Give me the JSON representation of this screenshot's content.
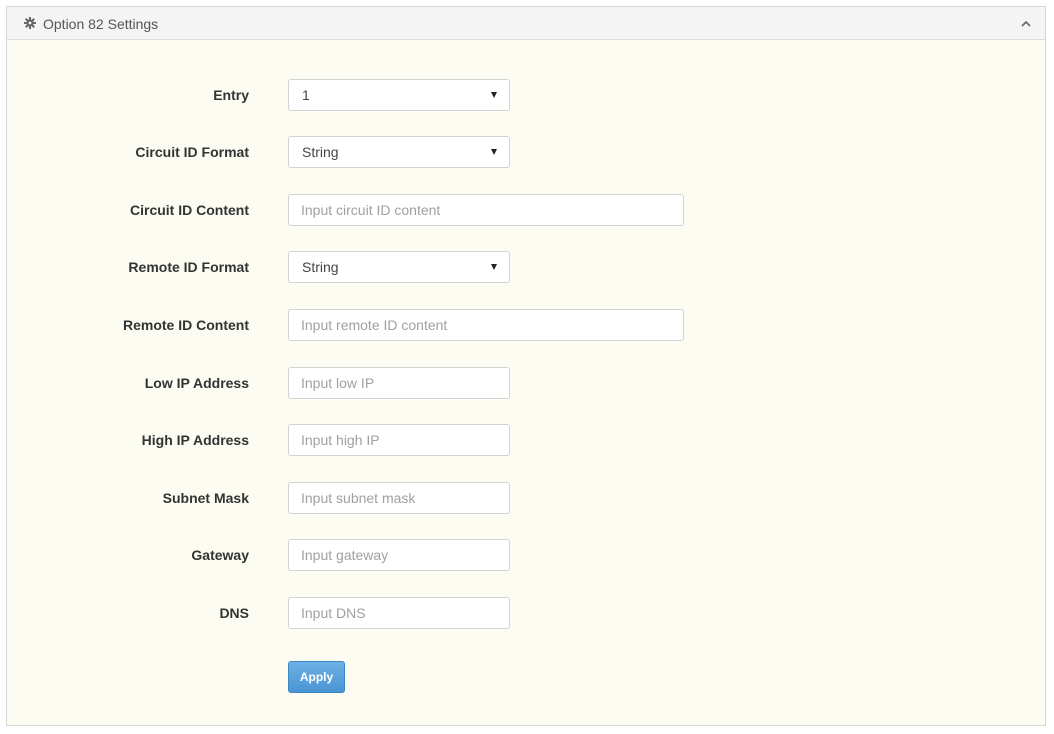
{
  "panel": {
    "title": "Option 82 Settings",
    "title_icon": "gear-icon",
    "collapse_icon": "chevron-up-icon"
  },
  "form": {
    "entry": {
      "label": "Entry",
      "value": "1"
    },
    "circuit_id_format": {
      "label": "Circuit ID Format",
      "value": "String"
    },
    "circuit_id_content": {
      "label": "Circuit ID Content",
      "value": "",
      "placeholder": "Input circuit ID content"
    },
    "remote_id_format": {
      "label": "Remote ID Format",
      "value": "String"
    },
    "remote_id_content": {
      "label": "Remote ID Content",
      "value": "",
      "placeholder": "Input remote ID content"
    },
    "low_ip": {
      "label": "Low IP Address",
      "value": "",
      "placeholder": "Input low IP"
    },
    "high_ip": {
      "label": "High IP Address",
      "value": "",
      "placeholder": "Input high IP"
    },
    "subnet_mask": {
      "label": "Subnet Mask",
      "value": "",
      "placeholder": "Input subnet mask"
    },
    "gateway": {
      "label": "Gateway",
      "value": "",
      "placeholder": "Input gateway"
    },
    "dns": {
      "label": "DNS",
      "value": "",
      "placeholder": "Input DNS"
    },
    "apply_label": "Apply"
  },
  "colors": {
    "panel_background": "#fcfcf3",
    "header_background": "#f4f4f4",
    "apply_button": "#4a95d4"
  }
}
